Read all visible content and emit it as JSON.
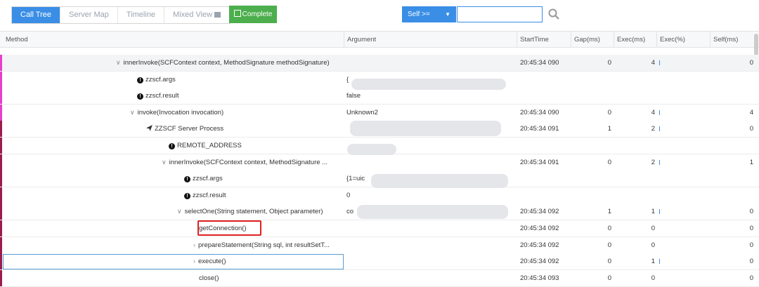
{
  "toolbar": {
    "tabs": [
      "Call Tree",
      "Server Map",
      "Timeline",
      "Mixed View"
    ],
    "complete_label": "Complete",
    "filter_select": "Self >=",
    "search_value": ""
  },
  "columns": [
    "Method",
    "Argument",
    "StartTime",
    "Gap(ms)",
    "Exec(ms)",
    "Exec(%)",
    "Self(ms)"
  ],
  "rows": [
    {
      "method": "innerInvoke(SCFContext context, MethodSignature methodSignature)",
      "argument": "",
      "start": "20:45:34 090",
      "gap": "0",
      "exec": "4",
      "self": "0"
    },
    {
      "method": "zzscf.args",
      "argument": "{",
      "start": "",
      "gap": "",
      "exec": "",
      "self": ""
    },
    {
      "method": "zzscf.result",
      "argument": "false",
      "start": "",
      "gap": "",
      "exec": "",
      "self": ""
    },
    {
      "method": "invoke(Invocation invocation)",
      "argument": "Unknown2",
      "start": "20:45:34 090",
      "gap": "0",
      "exec": "4",
      "self": "4"
    },
    {
      "method": "ZZSCF Server Process",
      "argument": "",
      "start": "20:45:34 091",
      "gap": "1",
      "exec": "2",
      "self": "0"
    },
    {
      "method": "REMOTE_ADDRESS",
      "argument": "",
      "start": "",
      "gap": "",
      "exec": "",
      "self": ""
    },
    {
      "method": "innerInvoke(SCFContext context, MethodSignature ...",
      "argument": "",
      "start": "20:45:34 091",
      "gap": "0",
      "exec": "2",
      "self": "1"
    },
    {
      "method": "zzscf.args",
      "argument": "{1=uic",
      "start": "",
      "gap": "",
      "exec": "",
      "self": ""
    },
    {
      "method": "zzscf.result",
      "argument": "0",
      "start": "",
      "gap": "",
      "exec": "",
      "self": ""
    },
    {
      "method": "selectOne(String statement, Object parameter)",
      "argument": "co",
      "start": "20:45:34 092",
      "gap": "1",
      "exec": "1",
      "self": "0"
    },
    {
      "method": "getConnection()",
      "argument": "",
      "start": "20:45:34 092",
      "gap": "0",
      "exec": "0",
      "self": "0"
    },
    {
      "method": "prepareStatement(String sql, int resultSetT...",
      "argument": "",
      "start": "20:45:34 092",
      "gap": "0",
      "exec": "0",
      "self": "0"
    },
    {
      "method": "execute()",
      "argument": "",
      "start": "20:45:34 092",
      "gap": "0",
      "exec": "1",
      "self": "0"
    },
    {
      "method": "close()",
      "argument": "",
      "start": "20:45:34 093",
      "gap": "0",
      "exec": "0",
      "self": "0"
    }
  ],
  "colors": {
    "accent": "#3a8ee6",
    "complete": "#4cae4c",
    "stripe_pink": "#e83ec9",
    "stripe_maroon": "#9c1c4e",
    "highlight": "#e02020"
  }
}
